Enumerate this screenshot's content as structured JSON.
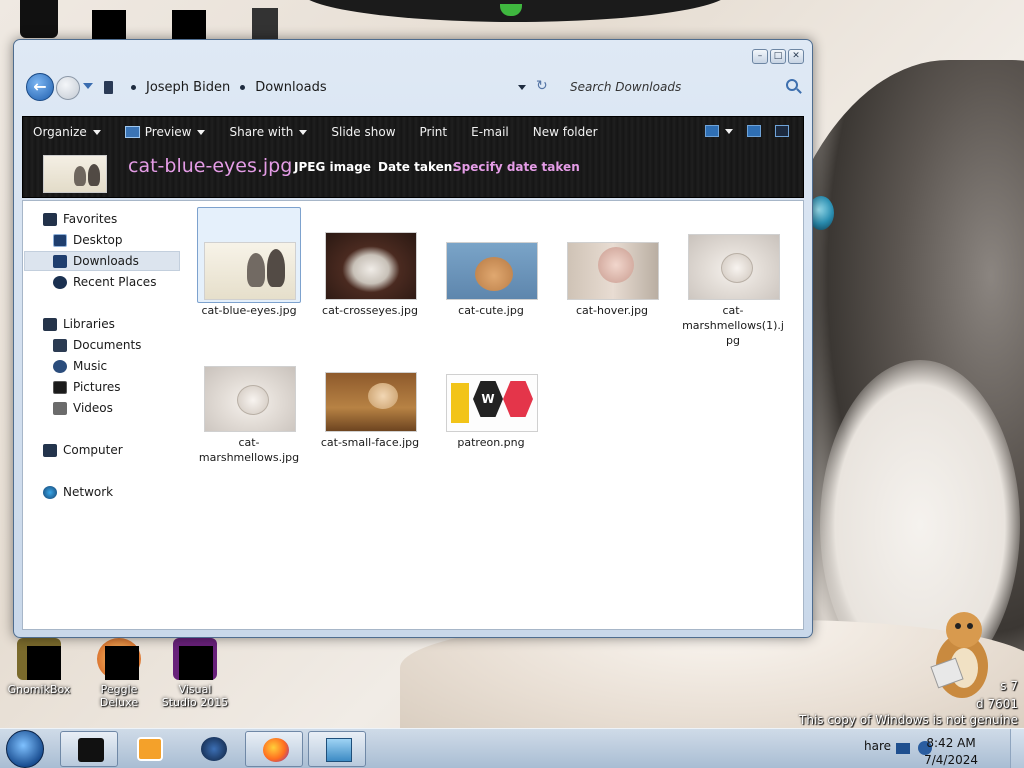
{
  "desktop": {
    "icons": [
      {
        "label": "GnomikBox"
      },
      {
        "label": "Peggle Deluxe"
      },
      {
        "label": "Visual Studio 2015"
      }
    ],
    "watermark_line1": "s 7",
    "watermark_line2": "d 7601",
    "watermark_line3": "This copy of Windows is not genuine"
  },
  "explorer": {
    "breadcrumb": [
      "Joseph Biden",
      "Downloads"
    ],
    "search_placeholder": "Search Downloads",
    "toolbar": {
      "organize": "Organize",
      "preview": "Preview",
      "share_with": "Share with",
      "slide_show": "Slide show",
      "print": "Print",
      "email": "E-mail",
      "new_folder": "New folder"
    },
    "details": {
      "file_name": "cat-blue-eyes.jpg",
      "file_type": "JPEG image",
      "date_label": "Date taken:",
      "date_value": "Specify date taken"
    },
    "nav": {
      "favorites": "Favorites",
      "desktop": "Desktop",
      "downloads": "Downloads",
      "recent_places": "Recent Places",
      "libraries": "Libraries",
      "documents": "Documents",
      "music": "Music",
      "pictures": "Pictures",
      "videos": "Videos",
      "computer": "Computer",
      "network": "Network"
    },
    "files": [
      {
        "name": "cat-blue-eyes.jpg"
      },
      {
        "name": "cat-crosseyes.jpg"
      },
      {
        "name": "cat-cute.jpg"
      },
      {
        "name": "cat-hover.jpg"
      },
      {
        "name": "cat-marshmellows(1).jpg"
      },
      {
        "name": "cat-marshmellows.jpg"
      },
      {
        "name": "cat-small-face.jpg"
      },
      {
        "name": "patreon.png"
      }
    ]
  },
  "taskbar": {
    "tray_text": "hare",
    "time": "8:42 AM",
    "date": "7/4/2024"
  },
  "colors": {
    "accent_pink": "#e49ce6",
    "toolbar_dark": "#1a1a1a",
    "selection": "#e5f0fb"
  }
}
